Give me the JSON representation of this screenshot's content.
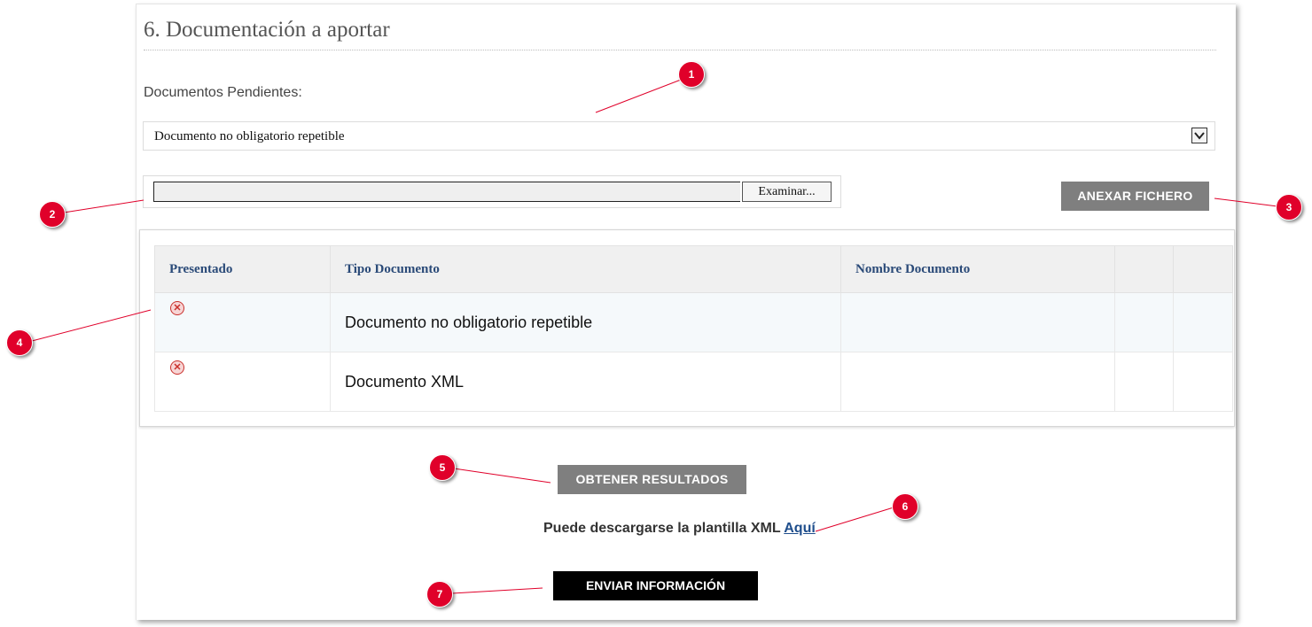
{
  "section": {
    "title": "6. Documentación a aportar"
  },
  "pending": {
    "label": "Documentos Pendientes:",
    "selected": "Documento no obligatorio repetible"
  },
  "file_input": {
    "browse_label": "Examinar..."
  },
  "annex_button": "ANEXAR FICHERO",
  "table": {
    "headers": [
      "Presentado",
      "Tipo Documento",
      "Nombre Documento",
      "",
      ""
    ],
    "rows": [
      {
        "tipo": "Documento no obligatorio repetible",
        "nombre": ""
      },
      {
        "tipo": "Documento XML",
        "nombre": ""
      }
    ]
  },
  "obtain_button": "OBTENER RESULTADOS",
  "download": {
    "text": "Puede descargarse la plantilla XML",
    "link": "Aquí"
  },
  "send_button": "ENVIAR INFORMACIÓN",
  "callouts": [
    "1",
    "2",
    "3",
    "4",
    "5",
    "6",
    "7"
  ],
  "colors": {
    "callout": "#e0002a",
    "gray_button": "#7f7f7f",
    "header_text": "#2a4a78"
  }
}
